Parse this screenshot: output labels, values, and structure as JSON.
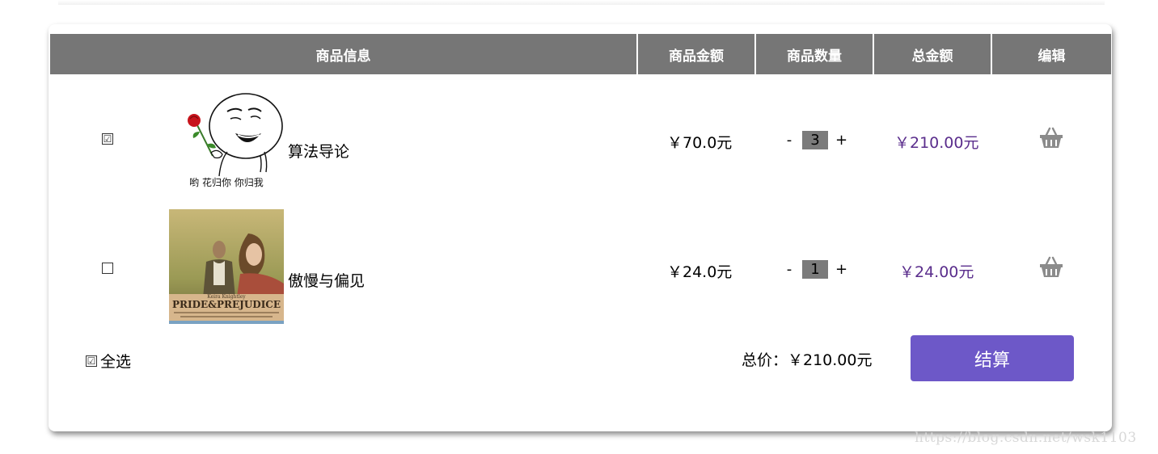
{
  "header": {
    "columns": [
      "商品信息",
      "商品金额",
      "商品数量",
      "总金额",
      "编辑"
    ]
  },
  "items": [
    {
      "checked": true,
      "check_glyph": "☑",
      "name": "算法导论",
      "image_caption": "哟 花归你 你归我",
      "price": "￥70.0元",
      "minus": "-",
      "quantity": "3",
      "plus": "+",
      "total": "￥210.00元",
      "delete_icon": "basket-icon"
    },
    {
      "checked": false,
      "check_glyph": "",
      "name": "傲慢与偏见",
      "image_caption_top": "Keira Knightley",
      "image_caption": "PRIDE&PREJUDICE",
      "price": "￥24.0元",
      "minus": "-",
      "quantity": "1",
      "plus": "+",
      "total": "￥24.00元",
      "delete_icon": "basket-icon"
    }
  ],
  "footer": {
    "select_all_glyph": "☑",
    "select_all_label": "全选",
    "sum_label": "总价：￥210.00元",
    "checkout_label": "结算"
  },
  "watermark": "https://blog.csdn.net/wsk1103",
  "colors": {
    "header_bg": "#767676",
    "total_text": "#5a2d8c",
    "checkout_bg": "#6d58c8",
    "qty_box": "#7b7b7b"
  }
}
